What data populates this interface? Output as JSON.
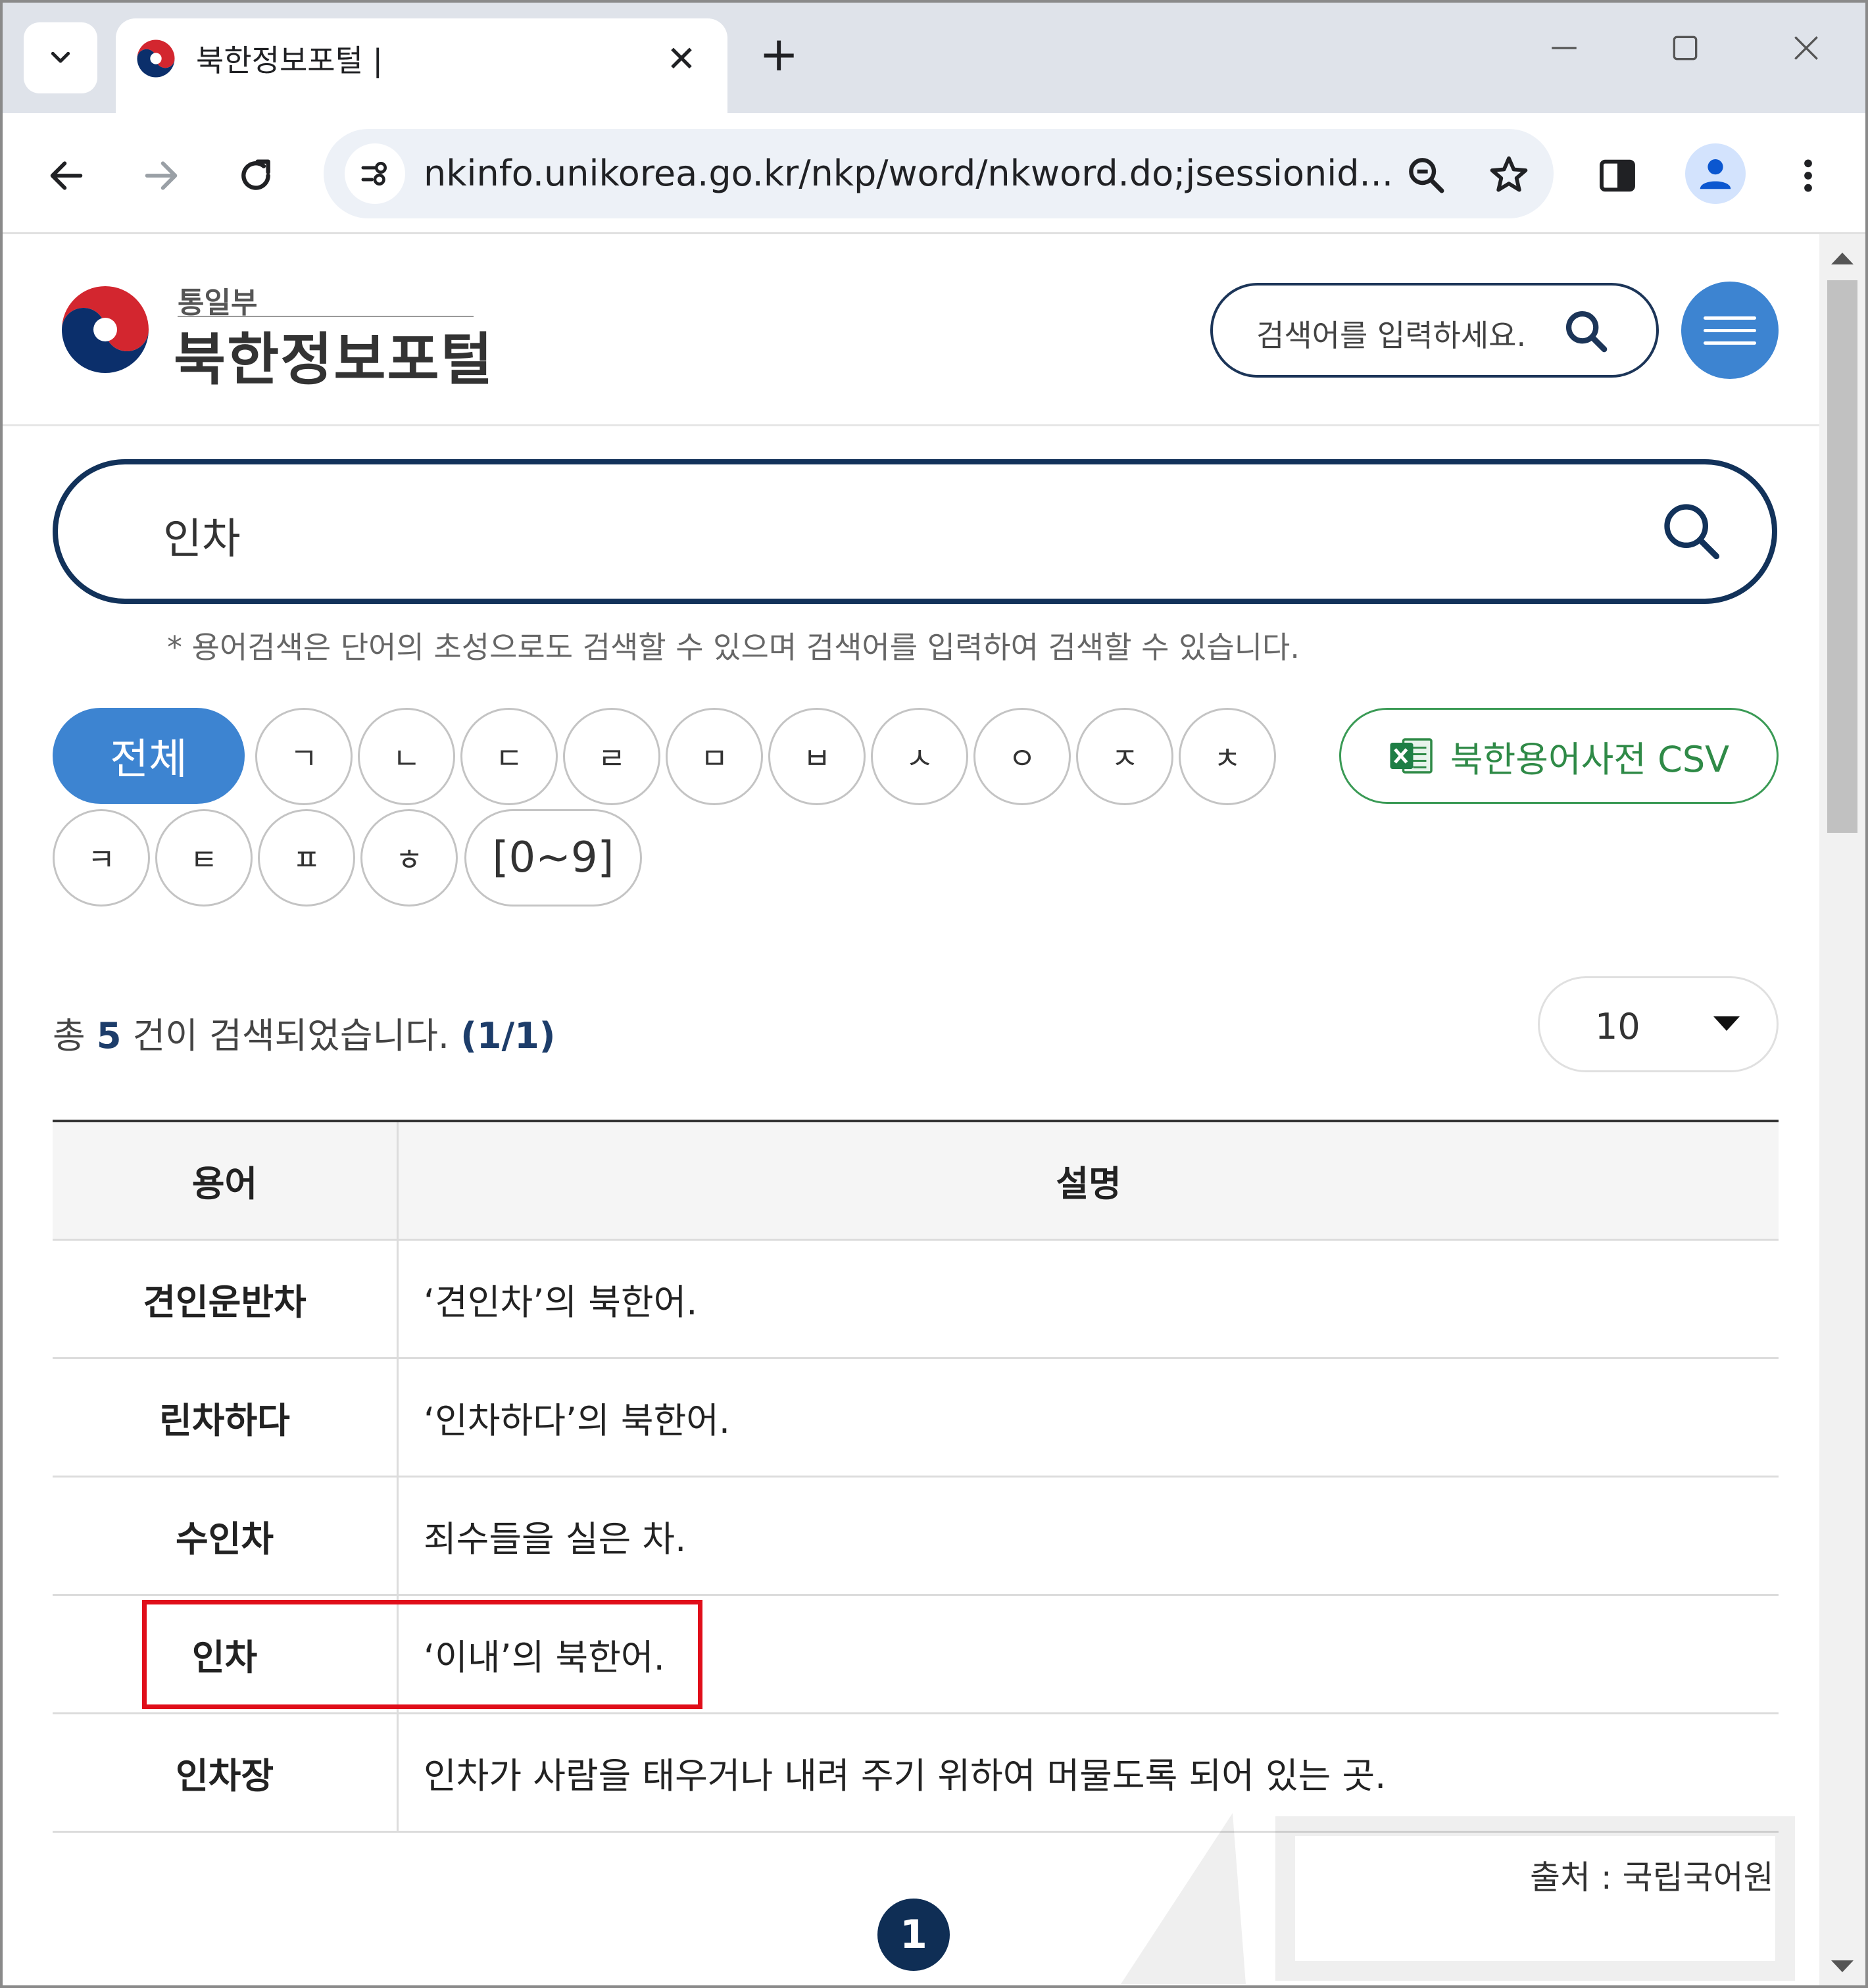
{
  "browser": {
    "tab_title": "북한정보포털 |",
    "tab_close": "✕",
    "new_tab": "+",
    "url": "nkinfo.unikorea.go.kr/nkp/word/nkword.do;jsessionid..."
  },
  "header": {
    "ministry": "통일부",
    "portal_name": "북한정보포털",
    "search_placeholder": "검색어를 입력하세요."
  },
  "search": {
    "value": "인차",
    "hint": "* 용어검색은 단어의 초성으로도 검색할 수 있으며 검색어를 입력하여 검색할 수 있습니다."
  },
  "filters": {
    "all_label": "전체",
    "row1": [
      "ㄱ",
      "ㄴ",
      "ㄷ",
      "ㄹ",
      "ㅁ",
      "ㅂ",
      "ㅅ",
      "ㅇ",
      "ㅈ",
      "ㅊ"
    ],
    "row2": [
      "ㅋ",
      "ㅌ",
      "ㅍ",
      "ㅎ"
    ],
    "numeric_label": "[0~9]",
    "csv_label": "북한용어사전 CSV"
  },
  "results": {
    "prefix": "총",
    "count": "5",
    "middle": "건이 검색되었습니다.",
    "page_info": "(1/1)",
    "page_size": "10"
  },
  "table": {
    "headers": [
      "용어",
      "설명"
    ],
    "rows": [
      {
        "term": "견인운반차",
        "desc": "‘견인차’의 북한어."
      },
      {
        "term": "린차하다",
        "desc": "‘인차하다’의 북한어."
      },
      {
        "term": "수인차",
        "desc": "죄수들을 실은 차."
      },
      {
        "term": "인차",
        "desc": "‘이내’의 북한어."
      },
      {
        "term": "인차장",
        "desc": "인차가 사람을 태우거나 내려 주기 위하여 머물도록 되어 있는 곳."
      }
    ]
  },
  "footer": {
    "source": "출처 : 국립국어원",
    "current_page": "1"
  },
  "colors": {
    "brand_blue": "#3d84d1",
    "navy": "#12325a",
    "highlight_red": "#e00e1a",
    "csv_green": "#3a9a55"
  },
  "icons": [
    "chevron-down-icon",
    "close-icon",
    "plus-icon",
    "minimize-icon",
    "maximize-icon",
    "back-icon",
    "forward-icon",
    "reload-icon",
    "site-info-icon",
    "zoom-icon",
    "star-icon",
    "side-panel-icon",
    "profile-icon",
    "more-icon",
    "search-icon",
    "menu-icon",
    "excel-icon"
  ]
}
